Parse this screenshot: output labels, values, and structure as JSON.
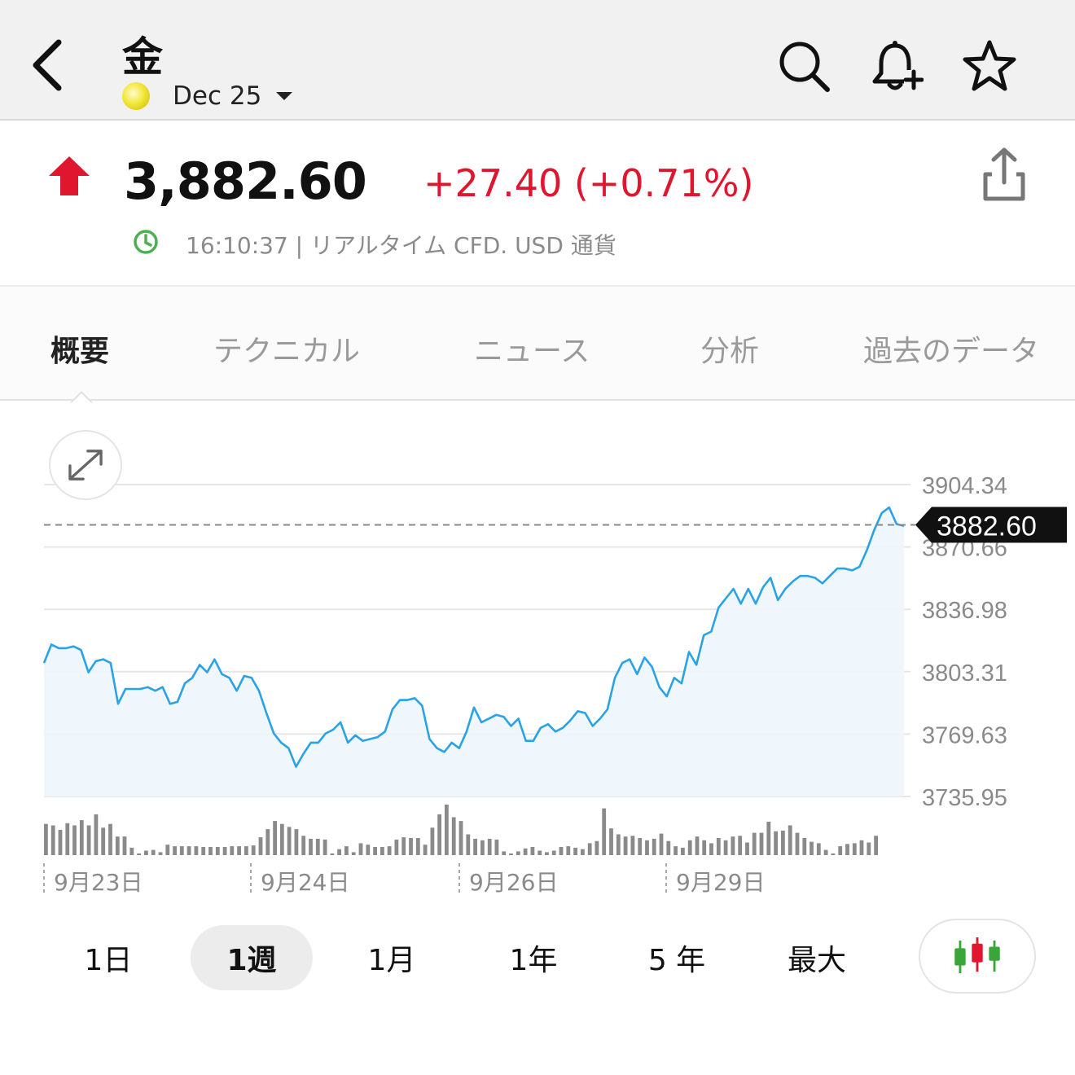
{
  "header": {
    "title": "金",
    "contract": "Dec 25",
    "icons": [
      "back-icon",
      "search-icon",
      "alert-add-icon",
      "star-icon"
    ]
  },
  "quote": {
    "price": "3,882.60",
    "change": "+27.40 (+0.71%)",
    "time": "16:10:37",
    "meta_text": "16:10:37 | リアルタイム CFD. USD 通貨",
    "up_color": "#e0152e",
    "clock_color": "#4caf50"
  },
  "tabs": [
    "概要",
    "テクニカル",
    "ニュース",
    "分析",
    "過去のデータ"
  ],
  "ranges": [
    "1日",
    "1週",
    "1月",
    "1年",
    "5 年",
    "最大"
  ],
  "active_range": "1週",
  "chart_data": {
    "type": "area",
    "y_ticks": [
      "3904.34",
      "3870.66",
      "3836.98",
      "3803.31",
      "3769.63",
      "3735.95"
    ],
    "ylim": [
      3735.95,
      3904.34
    ],
    "x_labels": [
      "9月23日",
      "9月24日",
      "9月26日",
      "9月29日"
    ],
    "current_value": "3882.60",
    "line_color": "#2aa3e6",
    "values": [
      3808,
      3818,
      3816,
      3816,
      3817,
      3815,
      3803,
      3809,
      3810,
      3808,
      3786,
      3794,
      3794,
      3794,
      3795,
      3793,
      3795,
      3786,
      3787,
      3797,
      3800,
      3807,
      3803,
      3810,
      3802,
      3800,
      3793,
      3801,
      3800,
      3793,
      3781,
      3770,
      3765,
      3762,
      3752,
      3759,
      3765,
      3765,
      3770,
      3772,
      3776,
      3765,
      3769,
      3766,
      3767,
      3768,
      3771,
      3783,
      3788,
      3788,
      3789,
      3785,
      3767,
      3762,
      3760,
      3765,
      3762,
      3771,
      3784,
      3776,
      3778,
      3780,
      3779,
      3774,
      3778,
      3766,
      3766,
      3773,
      3775,
      3771,
      3773,
      3777,
      3782,
      3781,
      3774,
      3778,
      3783,
      3800,
      3808,
      3810,
      3802,
      3811,
      3806,
      3795,
      3790,
      3800,
      3797,
      3814,
      3807,
      3823,
      3825,
      3838,
      3843,
      3848,
      3840,
      3848,
      3840,
      3849,
      3854,
      3842,
      3848,
      3852,
      3855,
      3855,
      3854,
      3851,
      3855,
      3859,
      3859,
      3858,
      3860,
      3869,
      3880,
      3889,
      3892,
      3883,
      3882
    ],
    "volume": [
      42,
      40,
      34,
      43,
      40,
      47,
      40,
      55,
      37,
      42,
      25,
      25,
      10,
      0,
      6,
      7,
      4,
      14,
      12,
      12,
      12,
      12,
      11,
      11,
      11,
      11,
      12,
      12,
      12,
      13,
      24,
      35,
      46,
      42,
      38,
      35,
      26,
      22,
      22,
      21,
      0,
      8,
      12,
      4,
      16,
      14,
      11,
      11,
      12,
      21,
      24,
      23,
      23,
      14,
      37,
      55,
      68,
      51,
      46,
      28,
      22,
      20,
      22,
      21,
      5,
      0,
      5,
      9,
      11,
      6,
      4,
      6,
      11,
      12,
      10,
      8,
      16,
      19,
      63,
      36,
      28,
      25,
      26,
      23,
      20,
      22,
      29,
      19,
      12,
      10,
      20,
      25,
      20,
      16,
      23,
      20,
      25,
      26,
      17,
      30,
      30,
      45,
      32,
      33,
      40,
      30,
      23,
      18,
      16,
      7,
      0,
      12,
      15,
      16,
      20,
      17,
      26
    ]
  }
}
